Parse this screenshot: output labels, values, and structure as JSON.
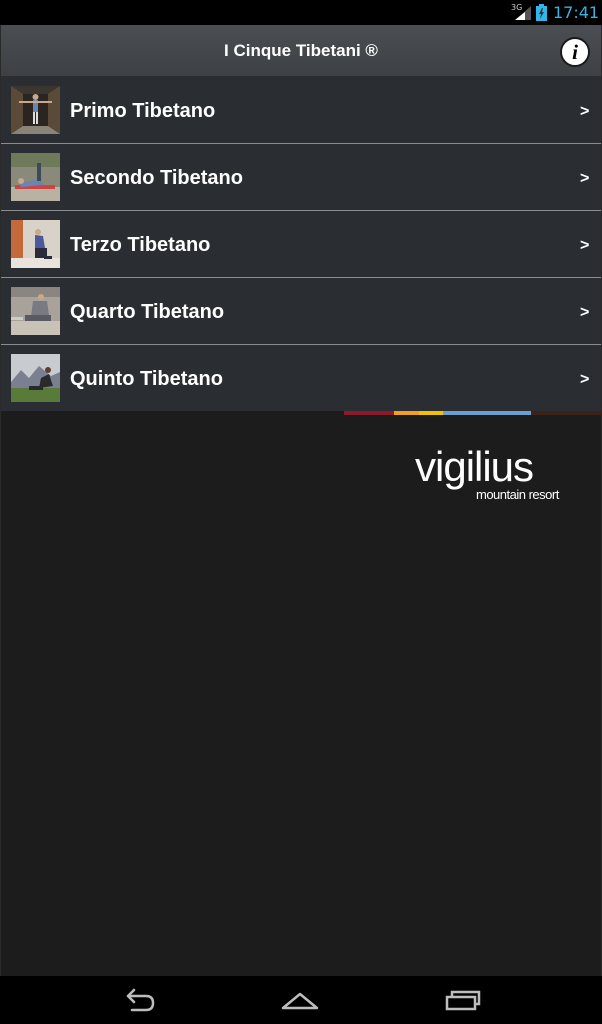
{
  "status_bar": {
    "network": "3G",
    "time": "17:41",
    "accent_color": "#33b5e5"
  },
  "action_bar": {
    "title": "I Cinque Tibetani ®",
    "info_icon": "info-icon"
  },
  "list": {
    "items": [
      {
        "label": "Primo Tibetano",
        "chevron": ">"
      },
      {
        "label": "Secondo Tibetano",
        "chevron": ">"
      },
      {
        "label": "Terzo Tibetano",
        "chevron": ">"
      },
      {
        "label": "Quarto Tibetano",
        "chevron": ">"
      },
      {
        "label": "Quinto Tibetano",
        "chevron": ">"
      }
    ]
  },
  "brand": {
    "name": "vigilius",
    "tagline": "mountain resort",
    "strip_colors": [
      "#8b1a2b",
      "#f0a020",
      "#f2c100",
      "#6a9fd0",
      "#3a2218"
    ]
  },
  "nav_bar": {
    "back_icon": "back-icon",
    "home_icon": "home-icon",
    "recents_icon": "recents-icon"
  }
}
